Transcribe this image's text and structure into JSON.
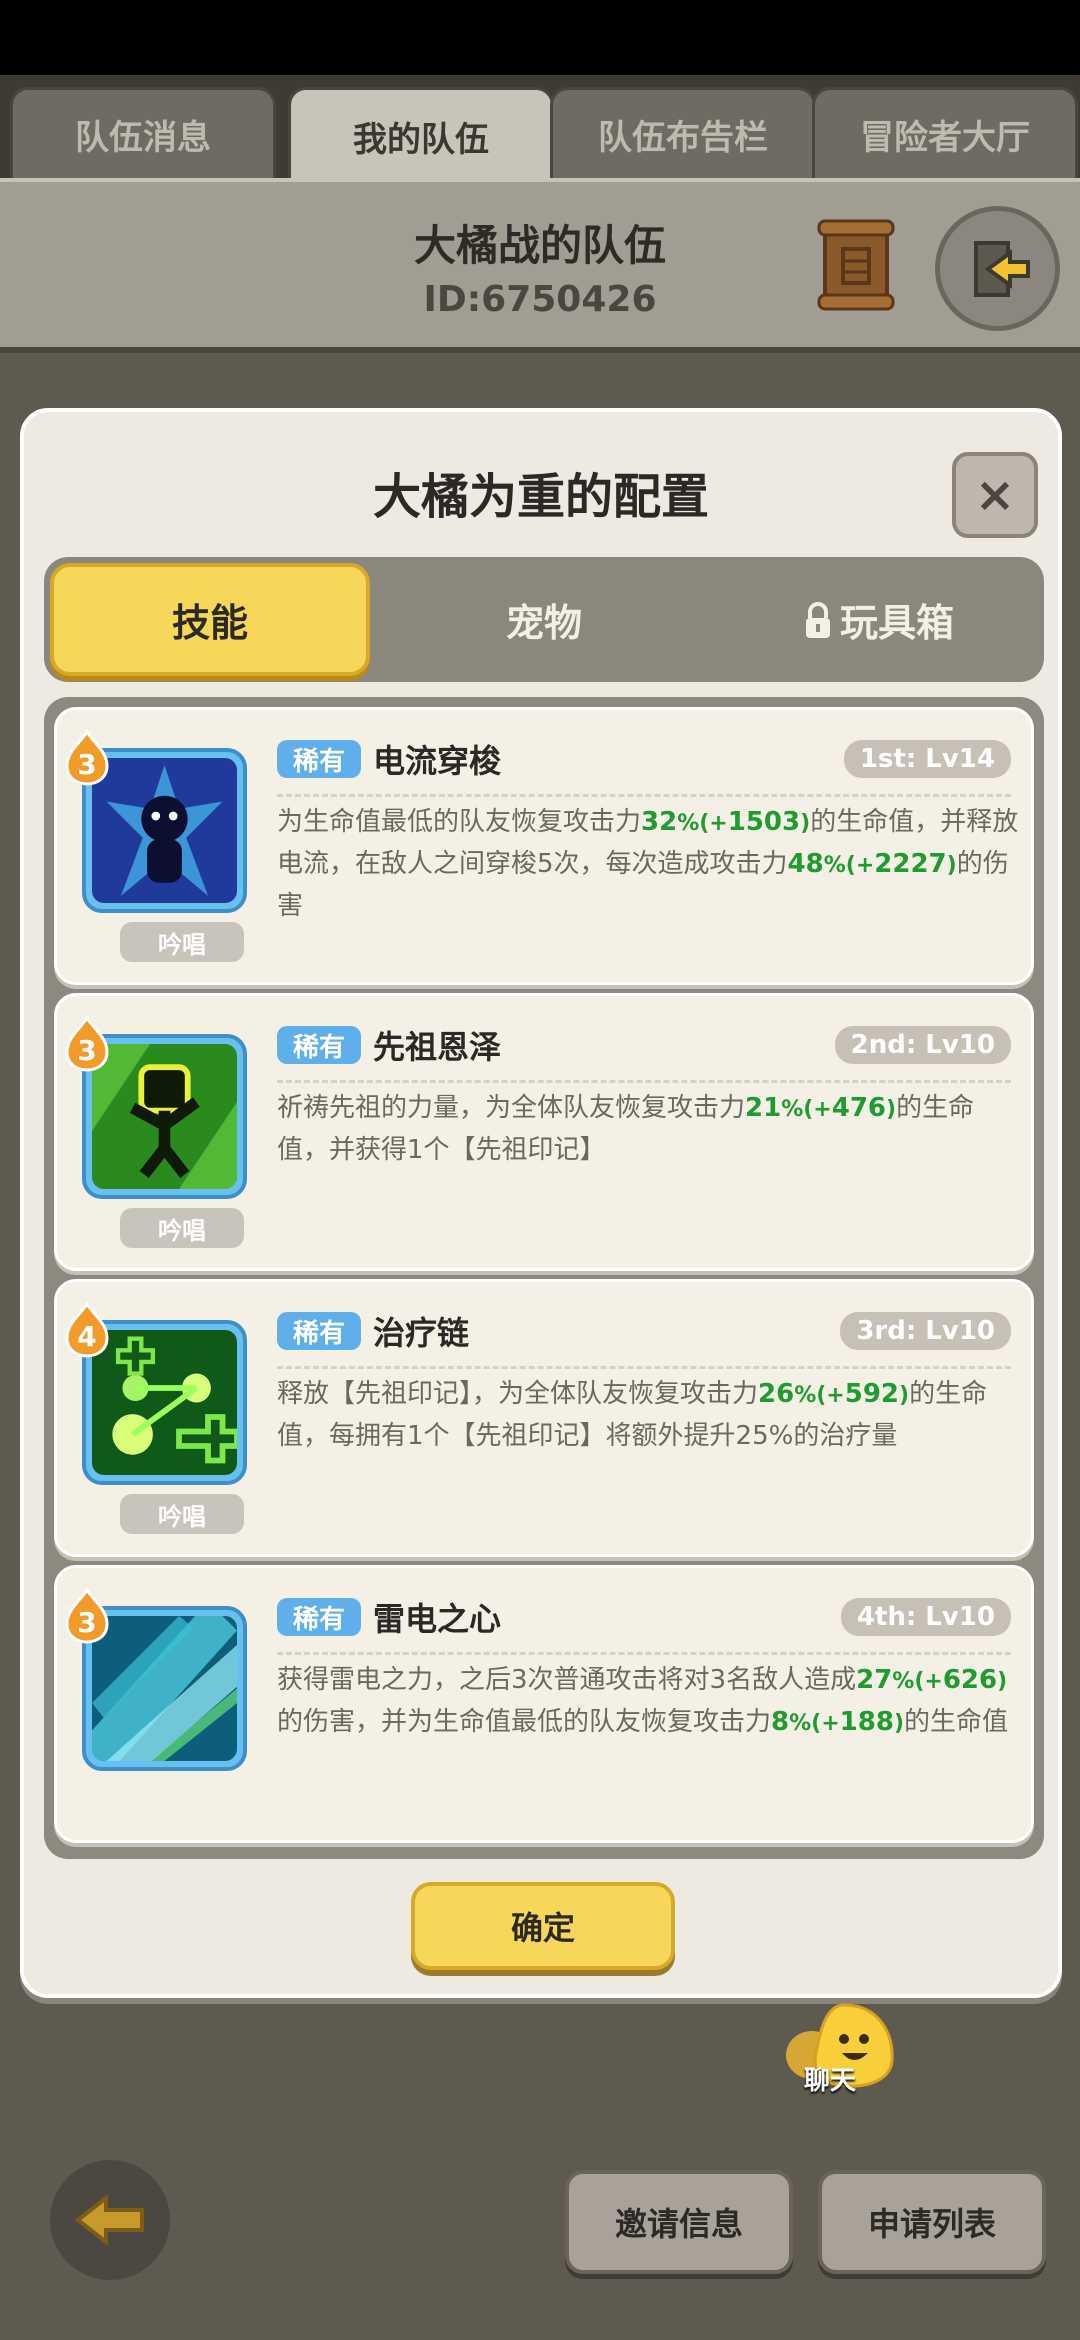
{
  "top_tabs": [
    {
      "label": "队伍消息"
    },
    {
      "label": "我的队伍"
    },
    {
      "label": "队伍布告栏"
    },
    {
      "label": "冒险者大厅"
    }
  ],
  "team": {
    "name": "大橘战的队伍",
    "id": "ID:6750426"
  },
  "modal": {
    "title": "大橘为重的配置",
    "close_label": "×",
    "segments": [
      {
        "label": "技能"
      },
      {
        "label": "宠物"
      },
      {
        "label": "玩具箱"
      }
    ],
    "skills": [
      {
        "badge": "3",
        "rarity": "稀有",
        "name": "电流穿梭",
        "level": "1st: Lv14",
        "chant": "吟唱",
        "desc_parts": [
          "为生命值最低的队友恢复攻击力",
          "32",
          "%",
          "(+",
          "1503",
          ")",
          "的生命值，并释放电流，在敌人之间穿梭5次，每次造成攻击力",
          "48",
          "%",
          "(+",
          "2227",
          ")",
          "的伤害"
        ]
      },
      {
        "badge": "3",
        "rarity": "稀有",
        "name": "先祖恩泽",
        "level": "2nd: Lv10",
        "chant": "吟唱",
        "desc_parts": [
          "祈祷先祖的力量，为全体队友恢复攻击力",
          "21",
          "%",
          "(+",
          "476",
          ")",
          "的生命值，并获得1个【先祖印记】"
        ]
      },
      {
        "badge": "4",
        "rarity": "稀有",
        "name": "治疗链",
        "level": "3rd: Lv10",
        "chant": "吟唱",
        "desc_parts": [
          "释放【先祖印记】，为全体队友恢复攻击力",
          "26",
          "%",
          "(+",
          "592",
          ")",
          "的生命值，每拥有1个【先祖印记】将额外提升25%的治疗量"
        ]
      },
      {
        "badge": "3",
        "rarity": "稀有",
        "name": "雷电之心",
        "level": "4th: Lv10",
        "desc_parts": [
          "获得雷电之力，之后3次普通攻击将对3名敌人造成",
          "27",
          "%",
          "(+",
          "626",
          ")",
          "的伤害，并为生命值最低的队友恢复攻击力",
          "8",
          "%",
          "(+",
          "188",
          ")",
          "的生命值"
        ]
      }
    ],
    "confirm_label": "确定"
  },
  "chat_label": "聊天",
  "bottom_buttons": [
    {
      "label": "邀请信息"
    },
    {
      "label": "申请列表"
    }
  ]
}
